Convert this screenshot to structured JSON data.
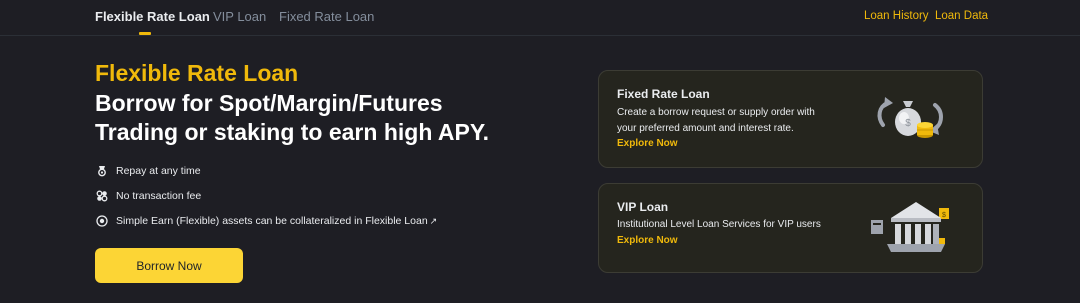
{
  "nav": {
    "tabs": [
      {
        "label": "Flexible Rate Loan",
        "active": true
      },
      {
        "label": "VIP Loan",
        "active": false
      },
      {
        "label": "Fixed Rate Loan",
        "active": false
      }
    ],
    "links": [
      "Loan History",
      "Loan Data"
    ]
  },
  "hero": {
    "title": "Flexible Rate Loan",
    "subtitle_line1": "Borrow for Spot/Margin/Futures",
    "subtitle_line2": "Trading or staking to earn high APY.",
    "features": [
      {
        "icon": "medal-icon",
        "text": "Repay at any time"
      },
      {
        "icon": "no-fee-icon",
        "text": "No transaction fee"
      },
      {
        "icon": "target-icon",
        "text": "Simple Earn (Flexible) assets can be collateralized in Flexible Loan",
        "ext": "↗"
      }
    ],
    "cta_label": "Borrow Now"
  },
  "cards": [
    {
      "title": "Fixed Rate Loan",
      "desc_line1": "Create a borrow request or supply order with",
      "desc_line2": "your preferred amount and interest rate.",
      "link": "Explore Now",
      "illustration": "money-bag-coins-icon"
    },
    {
      "title": "VIP Loan",
      "desc_line1": "Institutional Level Loan Services for VIP users",
      "link": "Explore Now",
      "illustration": "bank-building-icon"
    }
  ],
  "colors": {
    "background": "#1e1e24",
    "accent": "#f0b90b",
    "button": "#fcd535",
    "card_bg": "#25251e"
  }
}
